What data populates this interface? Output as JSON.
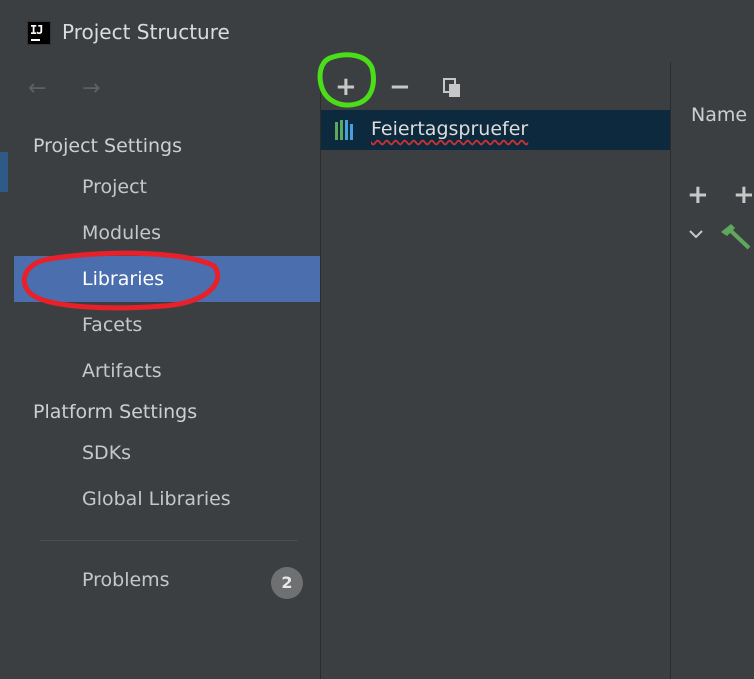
{
  "window": {
    "title": "Project Structure",
    "logo_text": "IJ"
  },
  "sidebar": {
    "back_arrow": "←",
    "forward_arrow": "→",
    "project_settings_heading": "Project Settings",
    "project_items": [
      {
        "label": "Project"
      },
      {
        "label": "Modules"
      },
      {
        "label": "Libraries",
        "selected": true
      },
      {
        "label": "Facets"
      },
      {
        "label": "Artifacts"
      }
    ],
    "platform_settings_heading": "Platform Settings",
    "platform_items": [
      {
        "label": "SDKs"
      },
      {
        "label": "Global Libraries"
      }
    ],
    "problems": {
      "label": "Problems",
      "count": "2"
    }
  },
  "libraries_panel": {
    "toolbar": {
      "add": "+",
      "remove": "−"
    },
    "items": [
      {
        "label": "Feiertagspruefer",
        "selected": true
      }
    ]
  },
  "details_panel": {
    "name_label": "Name",
    "toolbar": {
      "add": "+",
      "add_alt": "+"
    }
  },
  "colors": {
    "background": "#3c3f41",
    "selection": "#4b6eaf",
    "list_selection": "#0d293e",
    "annotation_red": "#e8202a",
    "annotation_green": "#4bdc1a"
  },
  "icons": {
    "logo": "intellij-icon",
    "copy": "copy-icon",
    "library": "library-icon",
    "hammer": "hammer-icon",
    "chevron": "chevron-down-icon"
  }
}
